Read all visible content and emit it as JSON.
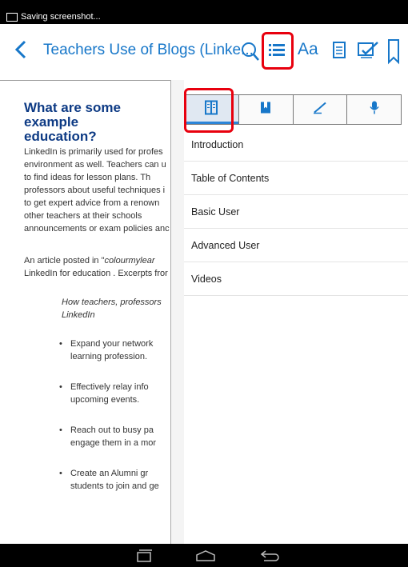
{
  "status_bar": {
    "notification": "Saving screenshot..."
  },
  "action_bar": {
    "title": "Teachers Use of Blogs (Linke...",
    "font_button_label": "Aa",
    "icons": [
      "back-icon",
      "search-icon",
      "toc-list-icon",
      "font-size-icon",
      "notes-icon",
      "annotate-icon",
      "bookmark-icon"
    ]
  },
  "article": {
    "heading_line1": "What are some example",
    "heading_line2": "education?",
    "paragraph1": [
      "LinkedIn is primarily used for profes",
      "environment as well. Teachers can u",
      "to find ideas for lesson plans. Th",
      "professors about useful techniques i",
      "to get expert advice from a renown",
      "other teachers at their schools",
      "announcements or exam policies anc"
    ],
    "paragraph2_prefix": "An article posted in \"",
    "paragraph2_source": "colourmylear",
    "paragraph2_line2": "LinkedIn for education . Excerpts fror",
    "quote_line1": "How teachers, professors",
    "quote_line2": "LinkedIn",
    "bullets": [
      [
        "Expand your network",
        "learning profession."
      ],
      [
        "Effectively relay info",
        "upcoming events."
      ],
      [
        "Reach out to busy pa",
        "engage them in a mor"
      ],
      [
        "Create an Alumni gr",
        "students to join and ge"
      ]
    ]
  },
  "panel": {
    "tabs": [
      "toc-tab-icon",
      "bookmarks-tab-icon",
      "annotations-tab-icon",
      "audio-tab-icon"
    ],
    "active_tab": 0,
    "items": [
      "Introduction",
      "Table of Contents",
      "Basic User",
      "Advanced User",
      "Videos"
    ]
  },
  "nav_bar": {
    "icons": [
      "recent-apps-icon",
      "home-icon",
      "back-nav-icon"
    ]
  },
  "colors": {
    "accent": "#1777c9",
    "heading": "#0d3a84",
    "highlight": "#e8000e"
  }
}
